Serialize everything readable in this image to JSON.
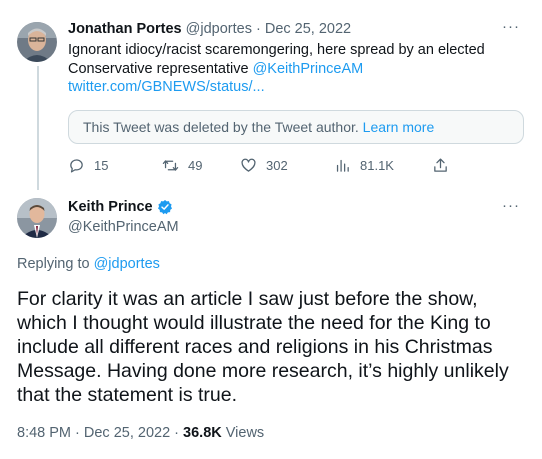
{
  "tweet1": {
    "name": "Jonathan Portes",
    "handle": "@jdportes",
    "separator": " · ",
    "date": "Dec 25, 2022",
    "more": "···",
    "text_line1": "Ignorant idiocy/racist scaremongering, here spread by an elected",
    "text_line2_prefix": "Conservative representative ",
    "mention": "@KeithPrinceAM",
    "link": "twitter.com/GBNEWS/status/...",
    "deleted_notice": "This Tweet was deleted by the Tweet author.",
    "learn_more": "Learn more",
    "stats": {
      "replies": "15",
      "retweets": "49",
      "likes": "302",
      "views": "81.1K"
    }
  },
  "tweet2": {
    "name": "Keith Prince",
    "handle": "@KeithPrinceAM",
    "more": "···",
    "replying_prefix": "Replying to ",
    "replying_to": "@jdportes",
    "text": "For clarity it was an article I saw just before the show, which I thought would illustrate the need for the King to include all different races and religions in his Christmas Message. Having done more research, it’s highly unlikely that the statement is true.",
    "time": "8:48 PM · Dec 25, 2022 · ",
    "views_count": "36.8K",
    "views_label": " Views"
  },
  "colors": {
    "accent": "#1d9bf0",
    "muted": "#536471",
    "text": "#0f1419",
    "border": "#cfd9de"
  },
  "icons": [
    "reply-icon",
    "retweet-icon",
    "like-icon",
    "views-icon",
    "share-icon",
    "verified-badge-icon",
    "more-icon"
  ]
}
